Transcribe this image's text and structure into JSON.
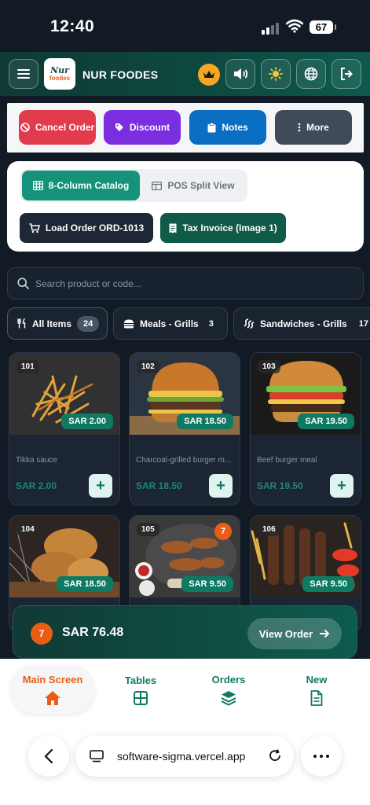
{
  "status": {
    "time": "12:40",
    "battery": "67"
  },
  "header": {
    "brand": "NUR FOODES",
    "logo_line1": "Nur",
    "logo_line2": "foodes"
  },
  "actions": {
    "cancel": "Cancel Order",
    "discount": "Discount",
    "notes": "Notes",
    "more": "More"
  },
  "views": {
    "catalog": "8-Column Catalog",
    "split": "POS Split View",
    "load_order": "Load Order ORD-1013",
    "tax_invoice": "Tax Invoice (Image 1)"
  },
  "search": {
    "placeholder": "Search product or code..."
  },
  "categories": [
    {
      "label": "All Items",
      "count": "24"
    },
    {
      "label": "Meals - Grills",
      "count": "3"
    },
    {
      "label": "Sandwiches - Grills",
      "count": "17"
    }
  ],
  "products": [
    {
      "id": "101",
      "badge": "SAR 2.00",
      "name": "Tikka sauce",
      "price": "SAR 2.00"
    },
    {
      "id": "102",
      "badge": "SAR 18.50",
      "name": "Charcoal-grilled burger m...",
      "price": "SAR 18.50"
    },
    {
      "id": "103",
      "badge": "SAR 19.50",
      "name": "Beef burger meal",
      "price": "SAR 19.50"
    },
    {
      "id": "104",
      "badge": "SAR 18.50"
    },
    {
      "id": "105",
      "badge": "SAR 9.50",
      "qty": "7"
    },
    {
      "id": "106",
      "badge": "SAR 9.50"
    }
  ],
  "cart": {
    "count": "7",
    "total": "SAR 76.48",
    "view": "View Order"
  },
  "tabs": [
    {
      "label": "Main Screen",
      "icon": "home-icon"
    },
    {
      "label": "Tables",
      "icon": "grid-icon"
    },
    {
      "label": "Orders",
      "icon": "layers-icon"
    },
    {
      "label": "New",
      "icon": "document-icon"
    }
  ],
  "browser": {
    "url": "software-sigma.vercel.app"
  },
  "colors": {
    "accent": "#0f7a63",
    "orange": "#ea5d16",
    "cancel": "#e23b4e",
    "discount": "#7a2ee0",
    "notes": "#0a6fc2",
    "more": "#3f4a5a"
  }
}
